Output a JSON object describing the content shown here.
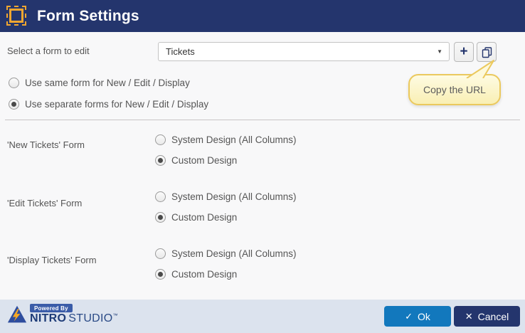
{
  "header": {
    "title": "Form Settings"
  },
  "form": {
    "select_label": "Select a form to edit",
    "selected_form": "Tickets",
    "add_button_label": "+",
    "copy_tooltip": "Copy the URL",
    "mode_options": [
      {
        "label": "Use same form for New / Edit / Display",
        "selected": false
      },
      {
        "label": "Use separate forms for New / Edit / Display",
        "selected": true
      }
    ],
    "sections": [
      {
        "label": "'New Tickets' Form",
        "options": [
          {
            "label": "System Design (All Columns)",
            "selected": false
          },
          {
            "label": "Custom Design",
            "selected": true
          }
        ]
      },
      {
        "label": "'Edit Tickets' Form",
        "options": [
          {
            "label": "System Design (All Columns)",
            "selected": false
          },
          {
            "label": "Custom Design",
            "selected": true
          }
        ]
      },
      {
        "label": "'Display Tickets' Form",
        "options": [
          {
            "label": "System Design (All Columns)",
            "selected": false
          },
          {
            "label": "Custom Design",
            "selected": true
          }
        ]
      }
    ]
  },
  "footer": {
    "logo": {
      "powered_by": "Powered By",
      "brand_bold": "NITRO",
      "brand_light": "STUDIO",
      "tm": "™"
    },
    "ok_label": "Ok",
    "ok_icon": "✓",
    "cancel_label": "Cancel",
    "cancel_icon": "✕"
  },
  "colors": {
    "header_navy": "#24356d",
    "accent_orange": "#f0a630",
    "ok_blue": "#1278bd",
    "footer_bg": "#dce3ee",
    "tooltip_bg": "#fcf6cf",
    "tooltip_border": "#ebc95e"
  }
}
